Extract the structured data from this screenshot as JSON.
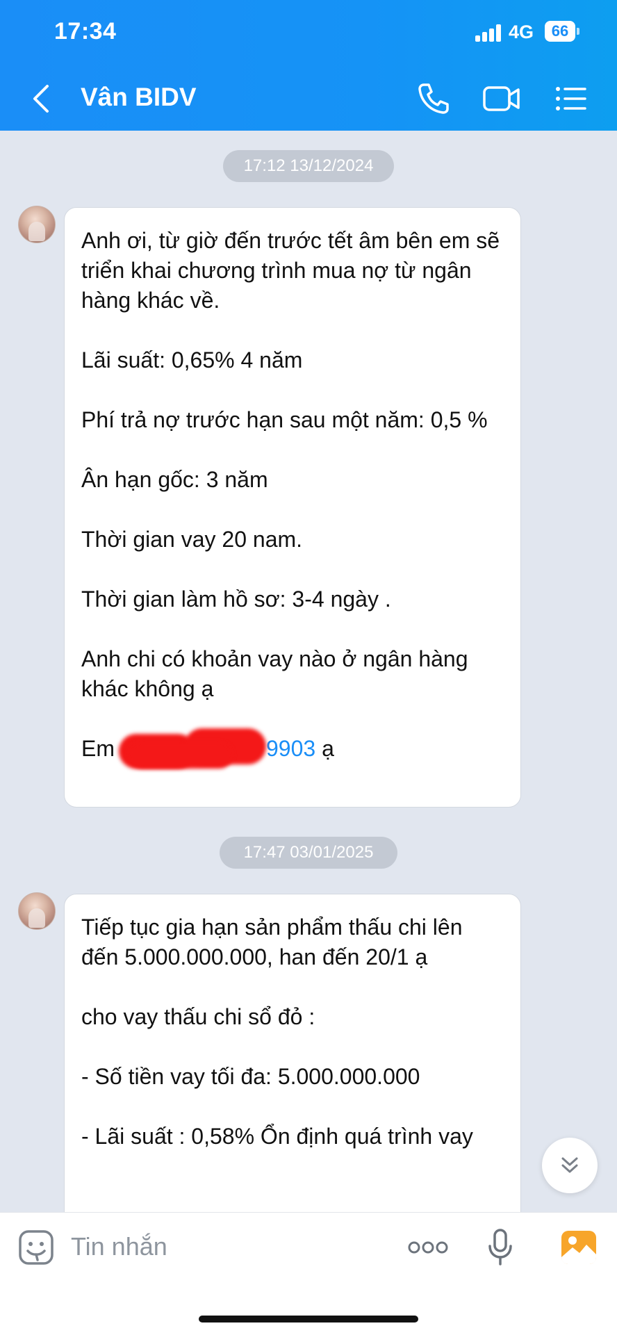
{
  "status_bar": {
    "time": "17:34",
    "network": "4G",
    "battery": "66"
  },
  "header": {
    "title": "Vân BIDV",
    "back_icon": "chevron-left-icon",
    "call_icon": "phone-icon",
    "video_icon": "video-camera-icon",
    "menu_icon": "list-menu-icon"
  },
  "messages": [
    {
      "timestamp": "17:12 13/12/2024",
      "paragraphs": [
        "Anh ơi, từ giờ đến trước tết âm bên em sẽ triển khai chương trình mua nợ từ ngân hàng khác về.",
        "Lãi suất: 0,65% 4 năm",
        "Phí trả nợ trước hạn sau một năm: 0,5 %",
        "Ân hạn gốc: 3 năm",
        "Thời gian vay 20 nam.",
        "Thời gian làm hồ sơ: 3-4 ngày .",
        "Anh chi  có  khoản vay nào ở ngân hàng khác không ạ"
      ],
      "last_line": {
        "prefix": "Em",
        "phone_suffix": "9903",
        "suffix": " ạ"
      }
    },
    {
      "timestamp": "17:47 03/01/2025",
      "paragraphs": [
        "Tiếp tục gia hạn sản phẩm thấu chi lên đến 5.000.000.000, han đến 20/1 ạ",
        "cho vay thấu chi sổ đỏ :",
        "- Số tiền vay tối đa: 5.000.000.000",
        "- Lãi suất : 0,58% Ổn định quá trình vay"
      ]
    }
  ],
  "input_bar": {
    "placeholder": "Tin nhắn",
    "sticker_icon": "sticker-icon",
    "more_icon": "more-dots-icon",
    "mic_icon": "microphone-icon",
    "image_icon": "image-icon"
  },
  "colors": {
    "header": "#1a8ef7",
    "link": "#1a8ef7",
    "background": "#e1e6ef",
    "image_icon": "#f7a52a"
  }
}
